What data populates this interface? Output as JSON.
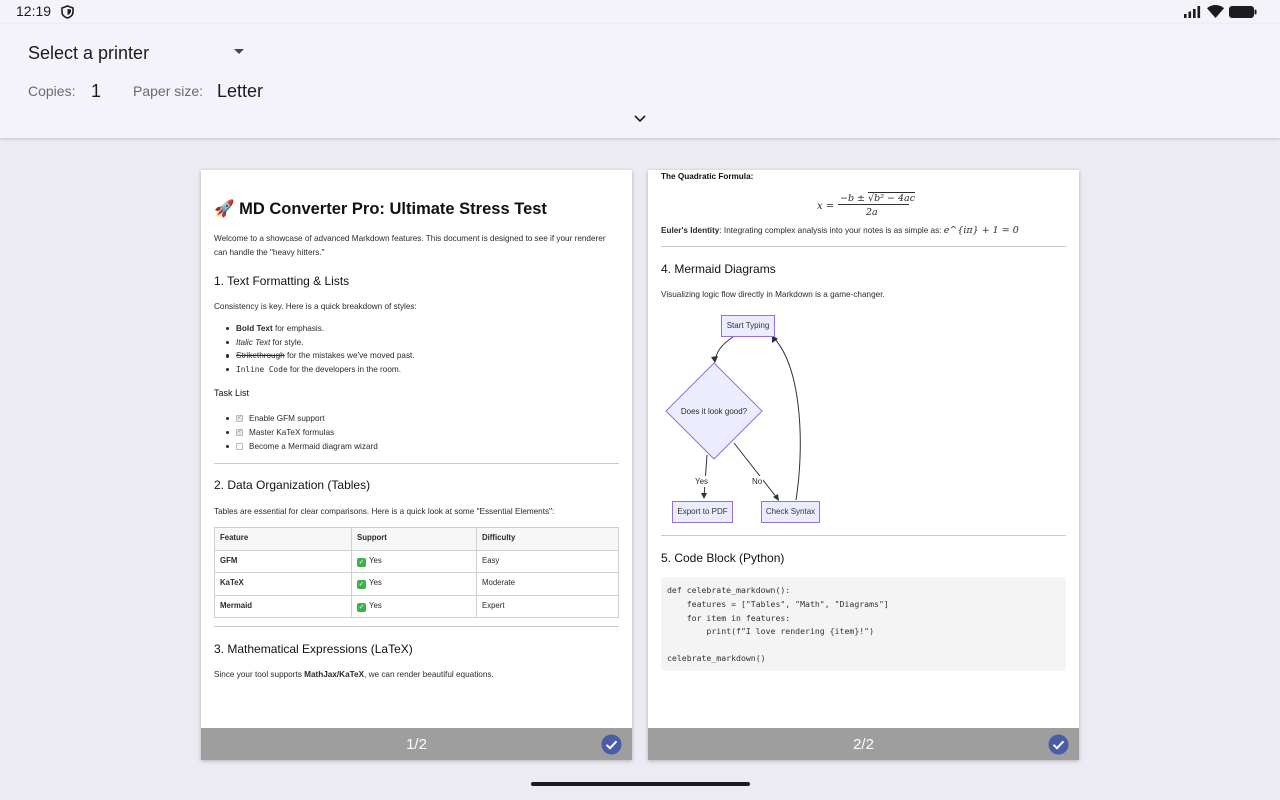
{
  "status_bar": {
    "time": "12:19",
    "icons": [
      "shield-icon",
      "signal-icon",
      "wifi-icon",
      "battery-icon"
    ]
  },
  "print_options": {
    "printer": "Select a printer",
    "copies_label": "Copies:",
    "copies_value": "1",
    "paper_size_label": "Paper size:",
    "paper_size_value": "Letter"
  },
  "colors": {
    "accent": "#4a5ba8",
    "footer": "#9e9e9e",
    "background": "#eceaf3"
  },
  "pages": [
    {
      "number": "1/2",
      "selected": true
    },
    {
      "number": "2/2",
      "selected": true
    }
  ],
  "doc": {
    "title_emoji": "🚀",
    "title": "MD Converter Pro: Ultimate Stress Test",
    "intro_line1": "Welcome to a showcase of advanced Markdown features. This document is designed to see if your renderer",
    "intro_line2": "can handle the \"heavy hitters.\"",
    "s1_heading": "1. Text Formatting & Lists",
    "s1_text": "Consistency is key. Here is a quick breakdown of styles:",
    "styles": [
      {
        "label": "Bold Text",
        "rest": " for emphasis."
      },
      {
        "label": "Italic Text",
        "rest": " for style."
      },
      {
        "label": "Strikethrough",
        "rest": " for the mistakes we've moved past."
      },
      {
        "label": "Inline Code",
        "rest": " for the developers in the room."
      }
    ],
    "tasklist_heading": "Task List",
    "tasks": [
      {
        "label": "Enable GFM support",
        "checked": true
      },
      {
        "label": "Master KaTeX formulas",
        "checked": true
      },
      {
        "label": "Become a Mermaid diagram wizard",
        "checked": false
      }
    ],
    "s2_heading": "2. Data Organization (Tables)",
    "s2_text": "Tables are essential for clear comparisons. Here is a quick look at some \"Essential Elements\":",
    "table": {
      "headers": [
        "Feature",
        "Support",
        "Difficulty"
      ],
      "rows": [
        [
          "GFM",
          "Yes",
          "Easy"
        ],
        [
          "KaTeX",
          "Yes",
          "Moderate"
        ],
        [
          "Mermaid",
          "Yes",
          "Expert"
        ]
      ]
    },
    "s3_heading": "3. Mathematical Expressions (LaTeX)",
    "s3_text_pre": "Since your tool supports ",
    "s3_text_bold": "MathJax/KaTeX",
    "s3_text_post": ", we can render beautiful equations.",
    "quad_label": "The Quadratic Formula:",
    "quad_lhs": "x =",
    "quad_num_pre": "−b ± ",
    "quad_sqrt": "b² − 4ac",
    "quad_den": "2a",
    "euler_label": "Euler's Identity",
    "euler_text": ": Integrating complex analysis into your notes is as simple as: ",
    "euler_formula": "e^{iπ} + 1 = 0",
    "s4_heading": "4. Mermaid Diagrams",
    "s4_text": "Visualizing logic flow directly in Markdown is a game-changer.",
    "mermaid": {
      "start": "Start Typing",
      "decision": "Does it look good?",
      "yes_label": "Yes",
      "no_label": "No",
      "export": "Export to PDF",
      "check": "Check Syntax"
    },
    "s5_heading": "5. Code Block (Python)",
    "code_lines": [
      "def celebrate_markdown():",
      "    features = [\"Tables\", \"Math\", \"Diagrams\"]",
      "    for item in features:",
      "        print(f\"I love rendering {item}!\")",
      "",
      "celebrate_markdown()"
    ]
  }
}
